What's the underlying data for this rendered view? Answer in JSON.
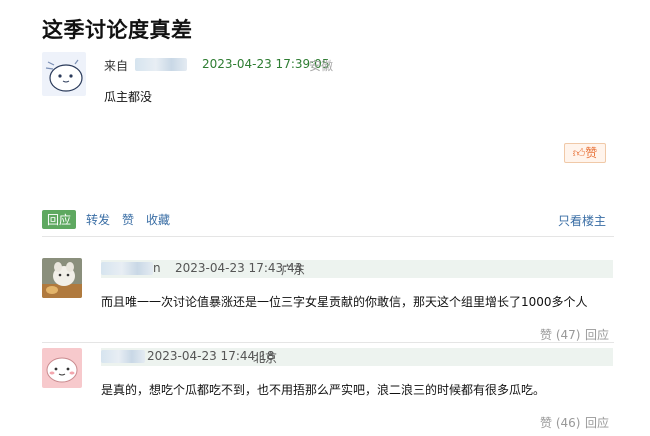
{
  "post": {
    "title": "这季讨论度真差",
    "from_label": "来自",
    "time": "2023-04-23 17:39:05",
    "location": "安徽",
    "body": "瓜主都没",
    "like_label": "赞"
  },
  "actions": {
    "reply": "回应",
    "share": "转发",
    "like": "赞",
    "collect": "收藏",
    "only_op": "只看楼主"
  },
  "replies": [
    {
      "name_fragment": "n",
      "time": "2023-04-23 17:43:43",
      "location": "广东",
      "body": "而且唯一一次讨论值暴涨还是一位三字女星贡献的你敢信，那天这个组里增长了1000多个人",
      "likes": "赞 (47)",
      "reply": "回应"
    },
    {
      "name_fragment": "",
      "time": "2023-04-23 17:44:18",
      "location": "北京",
      "body": "是真的，想吃个瓜都吃不到，也不用捂那么严实吧，浪二浪三的时候都有很多瓜吃。",
      "likes": "赞 (46)",
      "reply": "回应"
    }
  ],
  "colors": {
    "accent_green": "#5ea860",
    "time_green": "#2e7d32",
    "link_blue": "#3a6ea5",
    "like_orange": "#e8733a"
  }
}
